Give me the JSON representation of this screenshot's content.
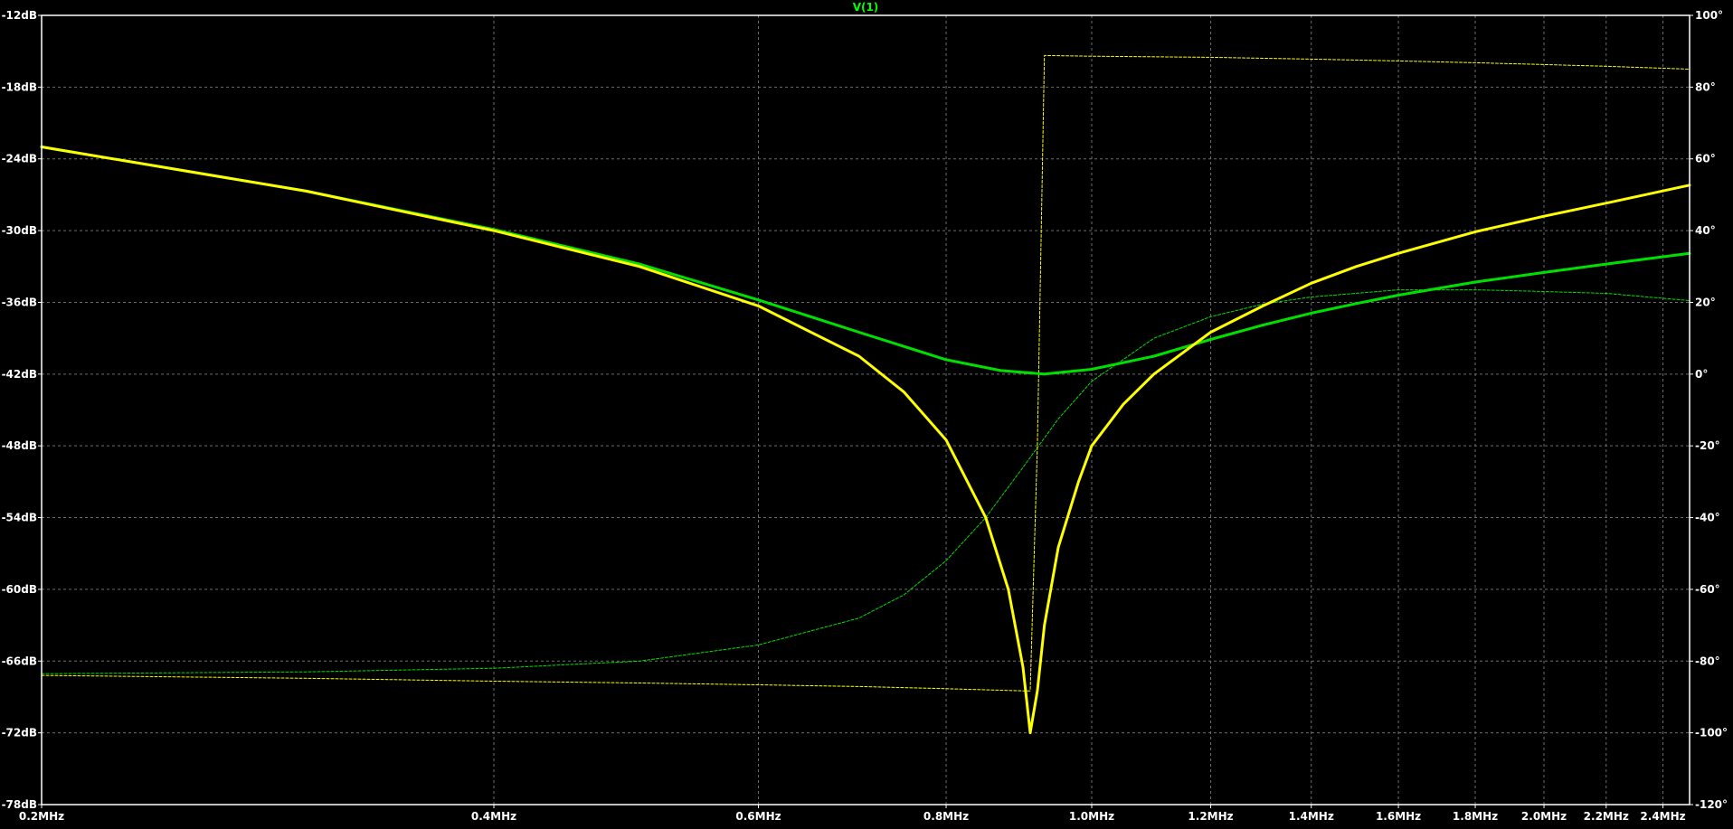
{
  "chart_data": {
    "type": "line",
    "title": "V(1)",
    "title_color": "#00ff00",
    "background_color": "#000000",
    "frame_color": "#ffffff",
    "grid": true,
    "grid_color": "#6e6e6e",
    "x_axis": {
      "scale": "log",
      "unit": "MHz",
      "range": [
        0.2,
        2.5
      ],
      "ticks": [
        0.2,
        0.4,
        0.6,
        0.8,
        1.0,
        1.2,
        1.4,
        1.6,
        1.8,
        2.0,
        2.2,
        2.4
      ],
      "tick_labels": [
        "0.2MHz",
        "0.4MHz",
        "0.6MHz",
        "0.8MHz",
        "1.0MHz",
        "1.2MHz",
        "1.4MHz",
        "1.6MHz",
        "1.8MHz",
        "2.0MHz",
        "2.2MHz",
        "2.4MHz"
      ]
    },
    "y_left": {
      "unit": "dB",
      "range": [
        -78,
        -12
      ],
      "ticks": [
        -12,
        -18,
        -24,
        -30,
        -36,
        -42,
        -48,
        -54,
        -60,
        -66,
        -72,
        -78
      ],
      "tick_labels": [
        "-12dB",
        "-18dB",
        "-24dB",
        "-30dB",
        "-36dB",
        "-42dB",
        "-48dB",
        "-54dB",
        "-60dB",
        "-66dB",
        "-72dB",
        "-78dB"
      ]
    },
    "y_right": {
      "unit": "°",
      "range": [
        -120,
        100
      ],
      "ticks": [
        100,
        80,
        60,
        40,
        20,
        0,
        -20,
        -40,
        -60,
        -80,
        -100,
        -120
      ],
      "tick_labels": [
        "100°",
        "80°",
        "60°",
        "40°",
        "20°",
        "0°",
        "-20°",
        "-40°",
        "-60°",
        "-80°",
        "-100°",
        "-120°"
      ]
    },
    "series": [
      {
        "color": "#00e000",
        "axis": "left",
        "style": "solid",
        "width": 3,
        "x": [
          0.2,
          0.3,
          0.4,
          0.5,
          0.6,
          0.7,
          0.8,
          0.87,
          0.93,
          1.0,
          1.1,
          1.2,
          1.3,
          1.4,
          1.5,
          1.6,
          1.8,
          2.0,
          2.2,
          2.5
        ],
        "y": [
          -23.0,
          -26.7,
          -29.9,
          -32.8,
          -35.8,
          -38.5,
          -40.8,
          -41.7,
          -42.0,
          -41.6,
          -40.5,
          -39.1,
          -37.9,
          -36.9,
          -36.1,
          -35.4,
          -34.3,
          -33.5,
          -32.8,
          -31.9
        ]
      },
      {
        "color": "#ffff00",
        "axis": "left",
        "style": "solid",
        "width": 3,
        "x": [
          0.2,
          0.3,
          0.4,
          0.5,
          0.6,
          0.7,
          0.75,
          0.8,
          0.85,
          0.88,
          0.9,
          0.91,
          0.92,
          0.93,
          0.95,
          0.98,
          1.0,
          1.05,
          1.1,
          1.2,
          1.3,
          1.4,
          1.5,
          1.6,
          1.8,
          2.0,
          2.2,
          2.5
        ],
        "y": [
          -23.0,
          -26.7,
          -30.0,
          -33.0,
          -36.3,
          -40.5,
          -43.5,
          -47.5,
          -54.0,
          -60.0,
          -66.5,
          -72.0,
          -68.5,
          -63.0,
          -56.5,
          -51.0,
          -48.0,
          -44.5,
          -42.0,
          -38.5,
          -36.3,
          -34.4,
          -33.0,
          -31.9,
          -30.1,
          -28.8,
          -27.7,
          -26.2
        ]
      },
      {
        "color": "#00e000",
        "axis": "right",
        "style": "dashed",
        "width": 1,
        "x": [
          0.2,
          0.3,
          0.4,
          0.5,
          0.6,
          0.7,
          0.75,
          0.8,
          0.85,
          0.9,
          0.95,
          1.0,
          1.1,
          1.2,
          1.3,
          1.4,
          1.6,
          1.8,
          2.0,
          2.2,
          2.5
        ],
        "y": [
          -83.5,
          -83.0,
          -82.0,
          -80.0,
          -75.5,
          -68.0,
          -61.5,
          -52.0,
          -40.0,
          -26.0,
          -12.5,
          -2.0,
          10.0,
          16.0,
          19.5,
          21.5,
          23.5,
          23.5,
          23.0,
          22.5,
          20.5
        ]
      },
      {
        "color": "#ffff00",
        "axis": "right",
        "style": "dashed",
        "width": 1,
        "x": [
          0.2,
          0.3,
          0.4,
          0.5,
          0.6,
          0.7,
          0.8,
          0.9,
          0.91,
          0.92,
          0.93,
          1.0,
          1.2,
          1.4,
          1.6,
          1.8,
          2.0,
          2.2,
          2.5
        ],
        "y": [
          -84.0,
          -84.8,
          -85.6,
          -86.1,
          -86.6,
          -87.1,
          -87.7,
          -88.3,
          -88.3,
          -20.0,
          88.8,
          88.6,
          88.3,
          87.8,
          87.3,
          86.8,
          86.3,
          85.8,
          85.0
        ]
      }
    ]
  }
}
